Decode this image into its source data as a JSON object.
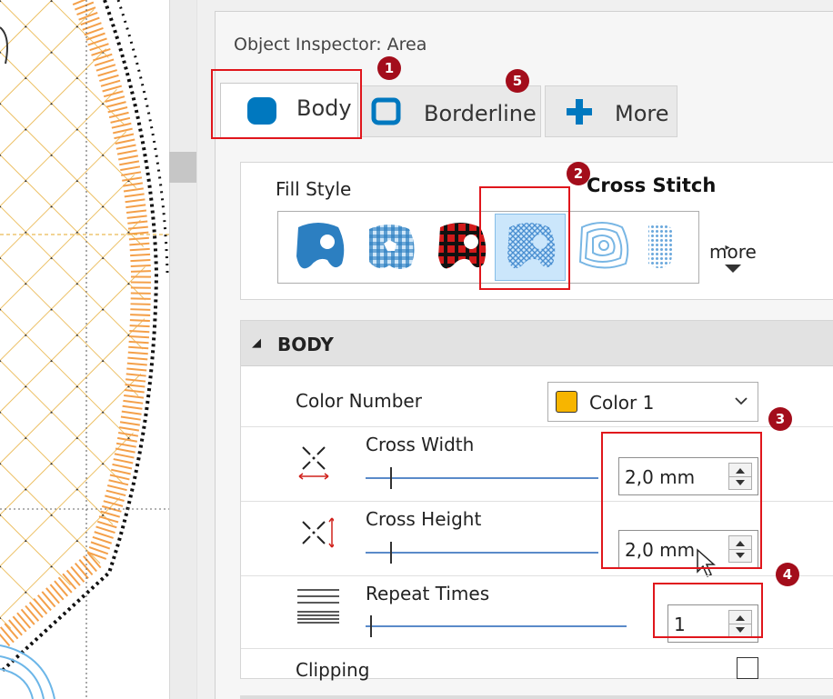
{
  "inspector": {
    "title": "Object Inspector: Area"
  },
  "tabs": [
    {
      "label": "Body"
    },
    {
      "label": "Borderline"
    },
    {
      "label": "More"
    }
  ],
  "badges": [
    "1",
    "2",
    "3",
    "4",
    "5"
  ],
  "fill_style": {
    "label": "Fill Style",
    "selected_name": "Cross Stitch",
    "more_label": "more",
    "thumbnails": [
      "satin-fill",
      "gingham-fill",
      "tartan-fill",
      "cross-stitch-fill",
      "contour-fill",
      "motif-fill"
    ]
  },
  "body": {
    "header": "BODY",
    "color_number": {
      "label": "Color Number",
      "value": "Color 1",
      "swatch": "#F7B500"
    },
    "cross_width": {
      "label": "Cross Width",
      "value": "2,0 mm"
    },
    "cross_height": {
      "label": "Cross Height",
      "value": "2,0 mm"
    },
    "repeat_times": {
      "label": "Repeat Times",
      "value": "1"
    },
    "clipping": {
      "label": "Clipping",
      "checked": false
    }
  },
  "colors": {
    "accent": "#0078BF",
    "highlight": "#E0161C",
    "badge": "#A30D1B",
    "thread": "#F7B500"
  }
}
